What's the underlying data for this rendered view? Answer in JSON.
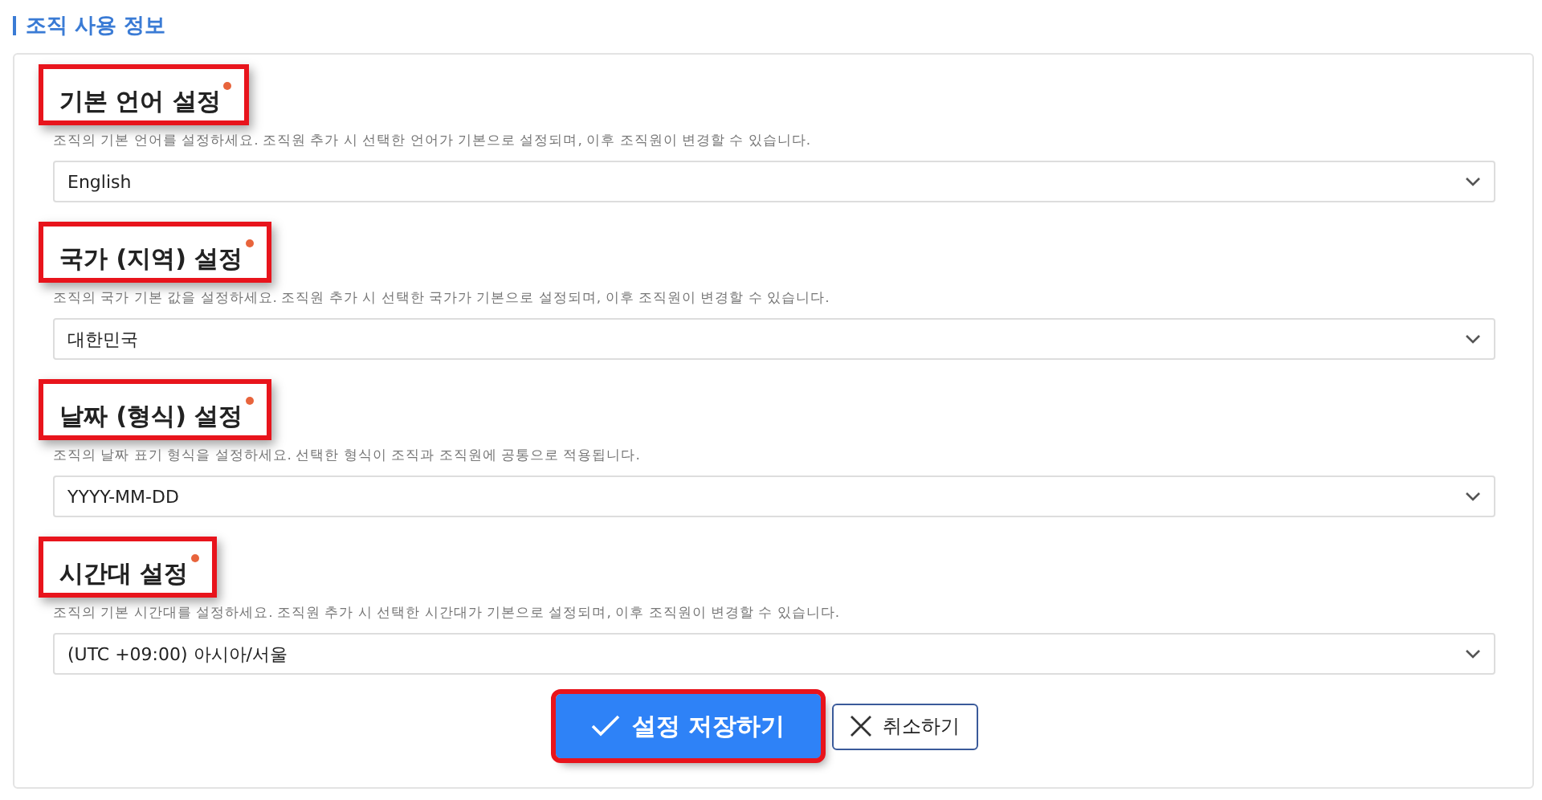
{
  "section": {
    "title": "조직 사용 정보"
  },
  "fields": [
    {
      "label": "기본 언어 설정",
      "required": true,
      "highlighted": true,
      "description": "조직의 기본 언어를 설정하세요. 조직원 추가 시 선택한 언어가 기본으로 설정되며, 이후 조직원이 변경할 수 있습니다.",
      "value": "English"
    },
    {
      "label": "국가 (지역) 설정",
      "required": true,
      "highlighted": true,
      "description": "조직의 국가 기본 값을 설정하세요. 조직원 추가 시 선택한 국가가 기본으로 설정되며, 이후 조직원이 변경할 수 있습니다.",
      "value": "대한민국"
    },
    {
      "label": "날짜 (형식) 설정",
      "required": true,
      "highlighted": true,
      "description": "조직의 날짜 표기 형식을 설정하세요. 선택한 형식이 조직과 조직원에 공통으로 적용됩니다.",
      "value": "YYYY-MM-DD"
    },
    {
      "label": "시간대 설정",
      "required": true,
      "highlighted": true,
      "description": "조직의 기본 시간대를 설정하세요. 조직원 추가 시 선택한 시간대가 기본으로 설정되며, 이후 조직원이 변경할 수 있습니다.",
      "value": "(UTC +09:00) 아시아/서울"
    }
  ],
  "buttons": [
    {
      "kind": "primary",
      "label": "설정 저장하기",
      "highlighted": true
    },
    {
      "kind": "secondary",
      "label": "취소하기",
      "highlighted": false
    }
  ]
}
